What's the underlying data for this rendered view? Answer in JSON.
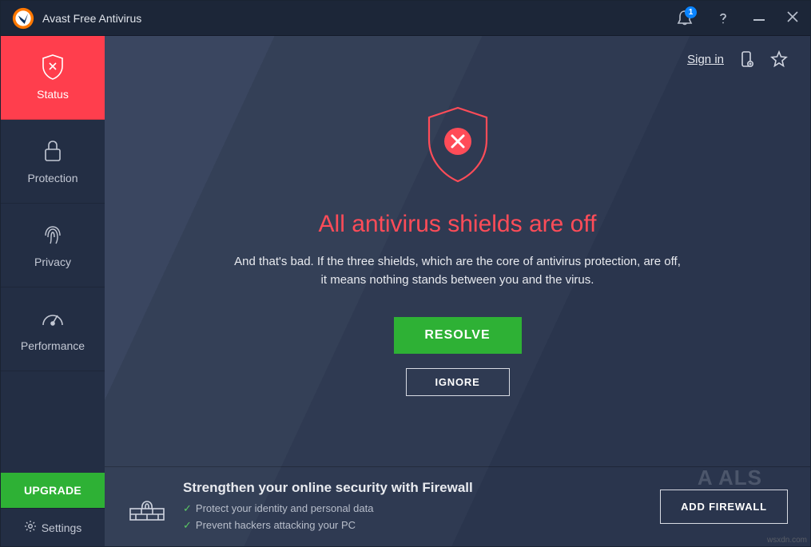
{
  "titlebar": {
    "app_title": "Avast Free Antivirus",
    "notification_count": "1"
  },
  "sidebar": {
    "items": [
      {
        "label": "Status"
      },
      {
        "label": "Protection"
      },
      {
        "label": "Privacy"
      },
      {
        "label": "Performance"
      }
    ],
    "upgrade_label": "UPGRADE",
    "settings_label": "Settings"
  },
  "top_actions": {
    "signin_label": "Sign in"
  },
  "main": {
    "headline": "All antivirus shields are off",
    "subtext": "And that's bad. If the three shields, which are the core of antivirus protection, are off, it means nothing stands between you and the virus.",
    "resolve_label": "RESOLVE",
    "ignore_label": "IGNORE"
  },
  "promo": {
    "title": "Strengthen your online security with Firewall",
    "bullet1": "Protect your identity and personal data",
    "bullet2": "Prevent hackers attacking your PC",
    "button_label": "ADD FIREWALL"
  },
  "colors": {
    "accent_red": "#ff3e4d",
    "accent_green": "#2eb135",
    "bg_dark": "#2c3850"
  },
  "watermark": {
    "text": "A    ALS",
    "src": "wsxdn.com"
  }
}
